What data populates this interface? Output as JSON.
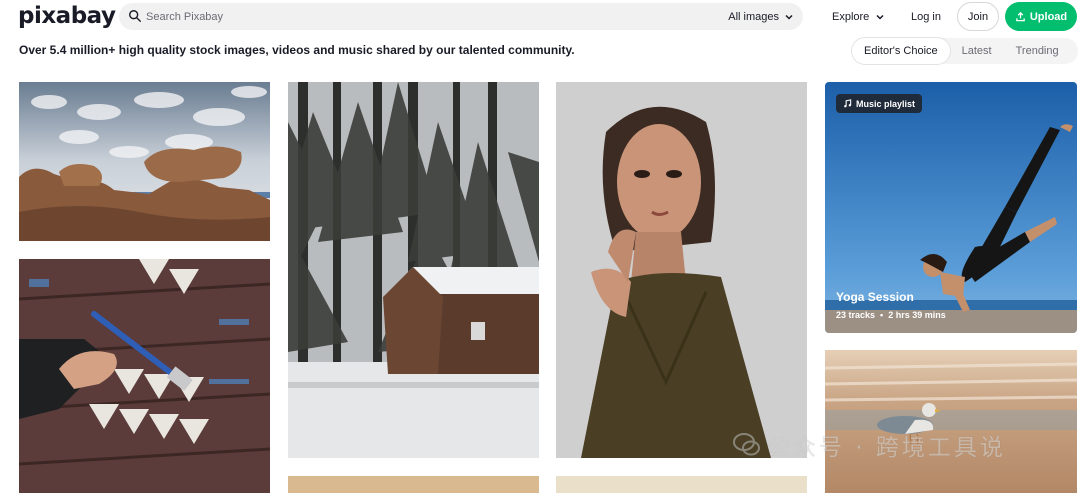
{
  "brand": {
    "logo": "pixabay",
    "accent": "#02be6e"
  },
  "search": {
    "placeholder": "Search Pixabay",
    "value": "",
    "filter_label": "All images"
  },
  "nav": {
    "explore": "Explore",
    "login": "Log in",
    "join": "Join",
    "upload": "Upload"
  },
  "tagline": "Over 5.4 million+ high quality stock images, videos and music shared by our talented community.",
  "tabs": [
    {
      "label": "Editor's Choice",
      "active": true
    },
    {
      "label": "Latest",
      "active": false
    },
    {
      "label": "Trending",
      "active": false
    }
  ],
  "playlist": {
    "badge": "Music playlist",
    "title": "Yoga Session",
    "tracks": "23 tracks",
    "separator": "•",
    "duration": "2 hrs 39 mins"
  },
  "watermark": "公众号 · 跨境工具说",
  "icons": {
    "search": "search-icon",
    "chevron": "chevron-down-icon",
    "upload": "upload-icon",
    "music": "music-note-icon",
    "wechat": "wechat-icon"
  }
}
